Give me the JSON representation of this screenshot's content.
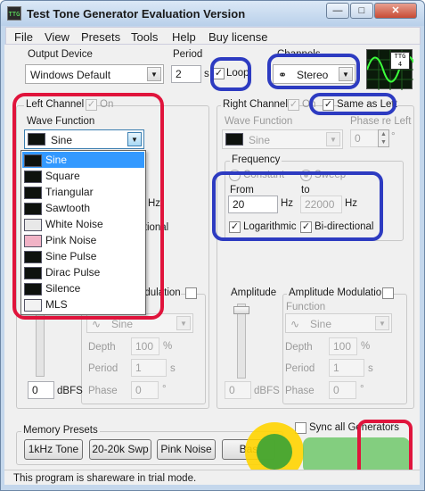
{
  "window": {
    "title": "Test Tone Generator Evaluation Version",
    "app_icon_text": "TTG",
    "controls": {
      "minimize": "—",
      "maximize": "□",
      "close": "✕"
    }
  },
  "menu": {
    "file": "File",
    "view": "View",
    "presets": "Presets",
    "tools": "Tools",
    "help": "Help",
    "buy": "Buy license"
  },
  "output_device": {
    "label": "Output Device",
    "value": "Windows Default"
  },
  "period": {
    "label": "Period",
    "value": "2",
    "unit": "s"
  },
  "loop": {
    "label": "Loop",
    "checked": true
  },
  "channels": {
    "label": "Channels",
    "value": "Stereo"
  },
  "ttg_badge": {
    "line1": "TTG",
    "line2": "4"
  },
  "left_channel": {
    "label": "Left Channel",
    "on_label": "On",
    "wave_function_label": "Wave Function",
    "wave_function_value": "Sine",
    "partial_hz": "Hz",
    "partial_directional": "ctional",
    "amp_modulation_partial": "odulation",
    "amplitude_value": "0",
    "amplitude_unit": "dBFS",
    "function_value": "Sine",
    "depth_label": "Depth",
    "depth_value": "100",
    "depth_unit": "%",
    "period_label": "Period",
    "period_value": "1",
    "period_unit": "s",
    "phase_label": "Phase",
    "phase_value": "0",
    "phase_unit": "°"
  },
  "wave_options": [
    "Sine",
    "Square",
    "Triangular",
    "Sawtooth",
    "White Noise",
    "Pink Noise",
    "Sine Pulse",
    "Dirac Pulse",
    "Silence",
    "MLS"
  ],
  "right_channel": {
    "label": "Right Channel",
    "on_label": "On",
    "same_as_left_label": "Same as Left",
    "wave_function_label": "Wave Function",
    "wave_function_value": "Sine",
    "phase_label": "Phase re Left",
    "phase_value": "0",
    "phase_unit": "°"
  },
  "frequency": {
    "label": "Frequency",
    "constant_label": "Constant",
    "sweep_label": "Sweep",
    "from_label": "From",
    "from_value": "20",
    "from_unit": "Hz",
    "to_label": "to",
    "to_value": "22000",
    "to_unit": "Hz",
    "logarithmic_label": "Logarithmic",
    "bidirectional_label": "Bi-directional"
  },
  "right_amplitude": {
    "label": "Amplitude",
    "value": "0",
    "unit": "dBFS"
  },
  "right_amp_mod": {
    "label": "Amplitude Modulation",
    "function_label": "Function",
    "function_value": "Sine",
    "depth_label": "Depth",
    "depth_value": "100",
    "depth_unit": "%",
    "period_label": "Period",
    "period_value": "1",
    "period_unit": "s",
    "phase_label": "Phase",
    "phase_value": "0",
    "phase_unit": "°"
  },
  "memory_presets": {
    "label": "Memory Presets",
    "buttons": [
      "1kHz Tone",
      "20-20k Swp",
      "Pink Noise",
      "Bas"
    ]
  },
  "sync_label": "Sync all Generators",
  "status": "This program is shareware in trial mode.",
  "colors": {
    "highlight_red": "#e0143c",
    "highlight_blue": "#2d3bc1",
    "selection": "#3399ff"
  }
}
